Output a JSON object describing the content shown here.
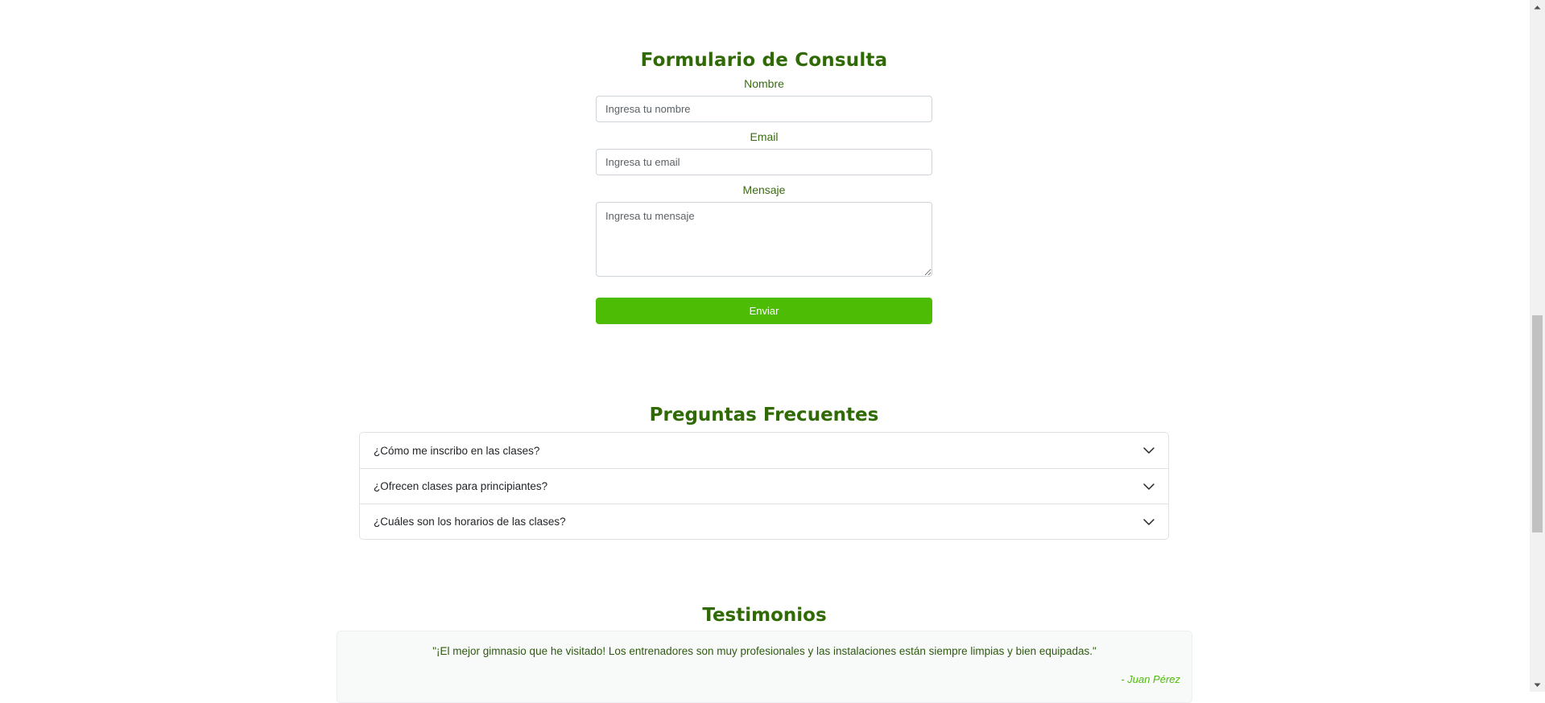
{
  "contact_form": {
    "title": "Formulario de Consulta",
    "name_label": "Nombre",
    "name_placeholder": "Ingresa tu nombre",
    "email_label": "Email",
    "email_placeholder": "Ingresa tu email",
    "message_label": "Mensaje",
    "message_placeholder": "Ingresa tu mensaje",
    "submit_label": "Enviar"
  },
  "faq": {
    "title": "Preguntas Frecuentes",
    "items": [
      {
        "question": "¿Cómo me inscribo en las clases?",
        "icon": "chevron-down-icon"
      },
      {
        "question": "¿Ofrecen clases para principiantes?",
        "icon": "chevron-down-icon"
      },
      {
        "question": "¿Cuáles son los horarios de las clases?",
        "icon": "chevron-down-icon"
      }
    ]
  },
  "testimonials": {
    "title": "Testimonios",
    "items": [
      {
        "quote": "\"¡El mejor gimnasio que he visitado! Los entrenadores son muy profesionales y las instalaciones están siempre limpias y bien equipadas.\"",
        "author": "- Juan Pérez"
      }
    ]
  },
  "colors": {
    "heading": "#2f6a05",
    "accent": "#4cbd04",
    "label": "#3a6a12",
    "card_background": "#f8f9f9"
  }
}
